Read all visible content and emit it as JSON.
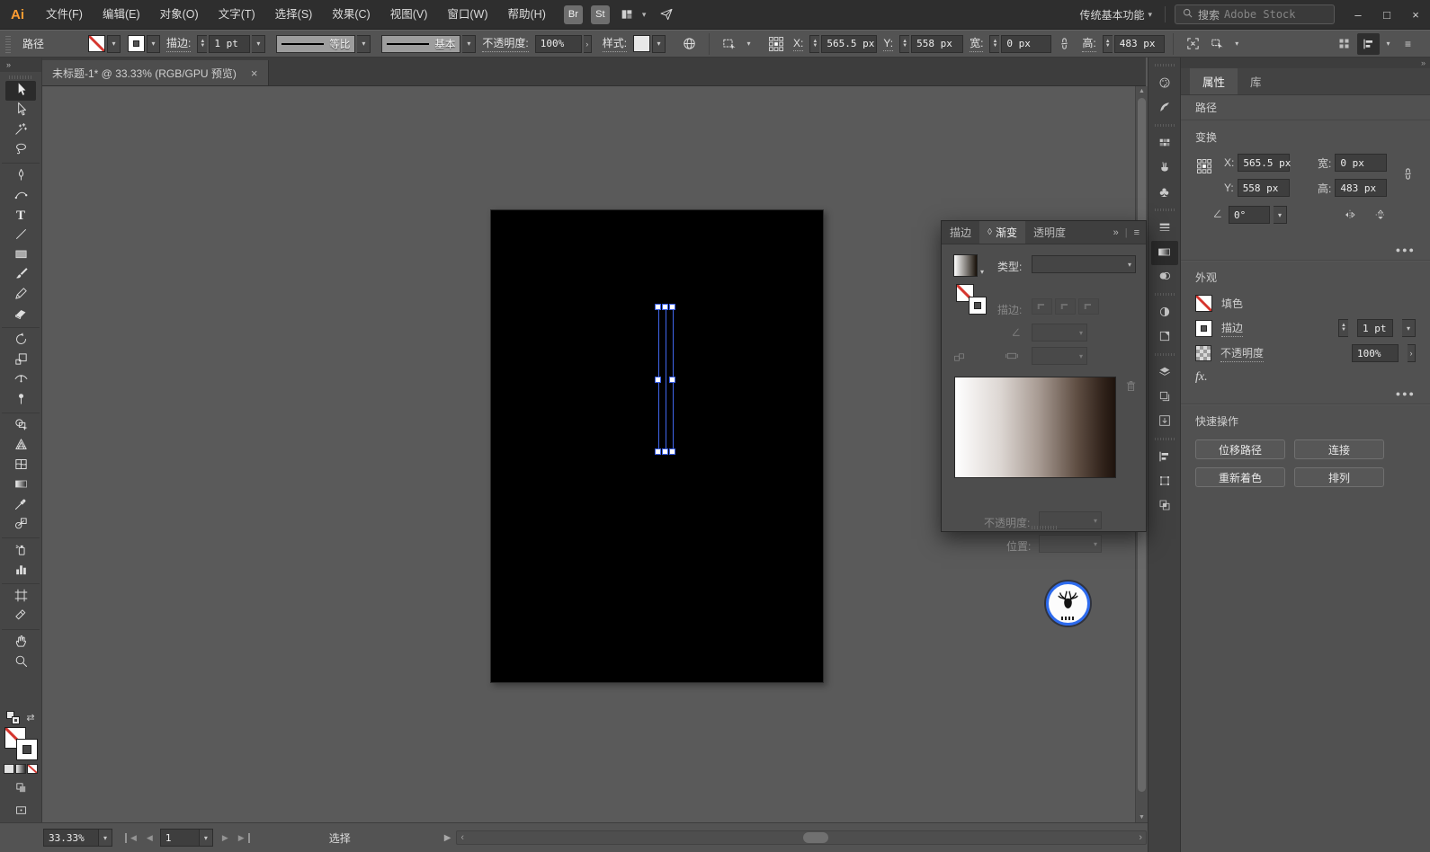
{
  "app": {
    "logo": "Ai",
    "workspace": "传统基本功能",
    "search_label": "搜索",
    "search_placeholder": "Adobe Stock",
    "window_controls": {
      "minimize": "–",
      "maximize": "□",
      "close": "×"
    },
    "accent_color": "#3f6af0",
    "none_color": "#d5352e"
  },
  "menu": {
    "items": [
      "文件(F)",
      "编辑(E)",
      "对象(O)",
      "文字(T)",
      "选择(S)",
      "效果(C)",
      "视图(V)",
      "窗口(W)",
      "帮助(H)"
    ],
    "badges": [
      "Br",
      "St"
    ]
  },
  "control_bar": {
    "context_label": "路径",
    "stroke_label": "描边:",
    "stroke_weight": "1 pt",
    "width_profile": "等比",
    "brush_definition": "基本",
    "opacity_label": "不透明度:",
    "opacity_value": "100%",
    "style_label": "样式:",
    "x_label": "X:",
    "x_value": "565.5 px",
    "y_label": "Y:",
    "y_value": "558 px",
    "w_label": "宽:",
    "w_value": "0 px",
    "h_label": "高:",
    "h_value": "483 px"
  },
  "toolbar": {
    "expand": "»",
    "tools": [
      {
        "name": "selection-tool",
        "icon": "selection",
        "active": true
      },
      {
        "name": "direct-selection-tool",
        "icon": "direct-selection"
      },
      {
        "name": "magic-wand-tool",
        "icon": "magic-wand"
      },
      {
        "name": "lasso-tool",
        "icon": "lasso"
      },
      {
        "name": "pen-tool",
        "icon": "pen",
        "sep": true
      },
      {
        "name": "curvature-tool",
        "icon": "curvature"
      },
      {
        "name": "type-tool",
        "icon": "type"
      },
      {
        "name": "line-segment-tool",
        "icon": "line"
      },
      {
        "name": "rectangle-tool",
        "icon": "rectangle"
      },
      {
        "name": "paintbrush-tool",
        "icon": "paintbrush"
      },
      {
        "name": "pencil-tool",
        "icon": "pencil"
      },
      {
        "name": "eraser-tool",
        "icon": "eraser"
      },
      {
        "name": "rotate-tool",
        "icon": "rotate",
        "sep": true
      },
      {
        "name": "scale-tool",
        "icon": "scale"
      },
      {
        "name": "width-tool",
        "icon": "width"
      },
      {
        "name": "puppet-warp-tool",
        "icon": "pin"
      },
      {
        "name": "shape-builder-tool",
        "icon": "shape-builder",
        "sep": true
      },
      {
        "name": "perspective-grid-tool",
        "icon": "perspective"
      },
      {
        "name": "mesh-tool",
        "icon": "mesh"
      },
      {
        "name": "gradient-tool",
        "icon": "gradient"
      },
      {
        "name": "eyedropper-tool",
        "icon": "eyedropper"
      },
      {
        "name": "blend-tool",
        "icon": "blend"
      },
      {
        "name": "symbol-sprayer-tool",
        "icon": "spray",
        "sep": true
      },
      {
        "name": "column-graph-tool",
        "icon": "graph"
      },
      {
        "name": "artboard-tool",
        "icon": "artboard",
        "sep": true
      },
      {
        "name": "slice-tool",
        "icon": "slice"
      },
      {
        "name": "hand-tool",
        "icon": "hand",
        "sep": true
      },
      {
        "name": "zoom-tool",
        "icon": "zoom"
      }
    ]
  },
  "document": {
    "tab_title": "未标题-1* @ 33.33% (RGB/GPU 预览)",
    "close": "×"
  },
  "canvas": {
    "artboard_color": "#000000",
    "background": "#5a5a5a",
    "selection_color": "#3f6af0"
  },
  "dock": {
    "items": [
      {
        "name": "color-panel-icon",
        "icon": "palette",
        "grp": true
      },
      {
        "name": "color-guide-panel-icon",
        "icon": "fan"
      },
      {
        "name": "swatches-panel-icon",
        "icon": "swatches",
        "grp": true
      },
      {
        "name": "brushes-panel-icon",
        "icon": "brush-cup"
      },
      {
        "name": "symbols-panel-icon",
        "icon": "club"
      },
      {
        "name": "stroke-panel-icon",
        "icon": "stroke-lines",
        "grp": true
      },
      {
        "name": "gradient-panel-icon",
        "icon": "gradient",
        "active": true
      },
      {
        "name": "transparency-panel-icon",
        "icon": "transparency"
      },
      {
        "name": "appearance-panel-icon",
        "icon": "appearance",
        "grp": true
      },
      {
        "name": "graphic-styles-panel-icon",
        "icon": "styles"
      },
      {
        "name": "layers-panel-icon",
        "icon": "layers",
        "grp": true
      },
      {
        "name": "artboards-panel-icon",
        "icon": "artboards"
      },
      {
        "name": "asset-export-panel-icon",
        "icon": "export"
      },
      {
        "name": "align-panel-icon",
        "icon": "align",
        "grp": true
      },
      {
        "name": "transform-panel-icon",
        "icon": "transform-p"
      },
      {
        "name": "pathfinder-panel-icon",
        "icon": "pathfinder"
      }
    ]
  },
  "gradient_panel": {
    "tabs": [
      {
        "label": "描边",
        "name": "tab-stroke"
      },
      {
        "label": "渐变",
        "name": "tab-gradient",
        "active": true
      },
      {
        "label": "透明度",
        "name": "tab-transparency"
      }
    ],
    "type_label": "类型:",
    "stroke_label": "描边:",
    "opacity_label": "不透明度:",
    "location_label": "位置:",
    "gradient": {
      "start": "#ffffff",
      "end": "#1e130d"
    }
  },
  "properties": {
    "tabs": [
      {
        "label": "属性",
        "name": "tab-properties",
        "active": true
      },
      {
        "label": "库",
        "name": "tab-libraries"
      }
    ],
    "context_label": "路径",
    "transform": {
      "title": "变换",
      "x_label": "X:",
      "x_value": "565.5 px",
      "y_label": "Y:",
      "y_value": "558 px",
      "w_label": "宽:",
      "w_value": "0 px",
      "h_label": "高:",
      "h_value": "483 px",
      "angle_value": "0°"
    },
    "appearance": {
      "title": "外观",
      "fill_label": "填色",
      "stroke_label": "描边",
      "stroke_weight": "1 pt",
      "opacity_label": "不透明度",
      "opacity_value": "100%",
      "fx_label": "fx."
    },
    "quick_actions": {
      "title": "快速操作",
      "buttons": [
        {
          "label": "位移路径",
          "name": "offset-path-button"
        },
        {
          "label": "连接",
          "name": "join-button"
        },
        {
          "label": "重新着色",
          "name": "recolor-button"
        },
        {
          "label": "排列",
          "name": "arrange-button"
        }
      ]
    }
  },
  "status_bar": {
    "zoom": "33.33%",
    "artboard_number": "1",
    "message": "选择"
  }
}
